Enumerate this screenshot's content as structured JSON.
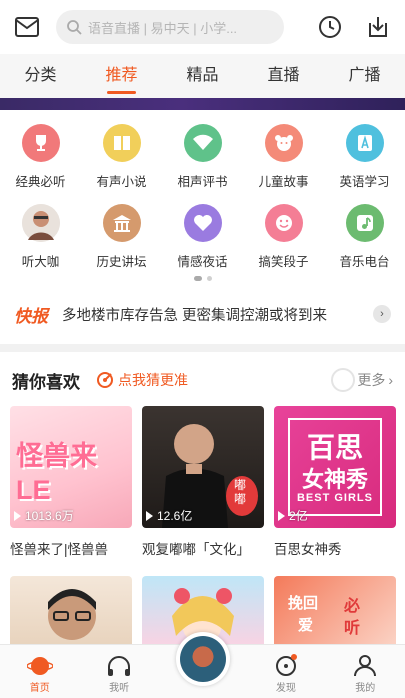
{
  "search": {
    "placeholder": "语音直播 | 易中天 | 小学..."
  },
  "tabs": [
    {
      "label": "分类"
    },
    {
      "label": "推荐"
    },
    {
      "label": "精品"
    },
    {
      "label": "直播"
    },
    {
      "label": "广播"
    }
  ],
  "categories": [
    {
      "label": "经典必听",
      "icon": "trophy-icon",
      "color": "#f1797a"
    },
    {
      "label": "有声小说",
      "icon": "book-icon",
      "color": "#f1cf5a"
    },
    {
      "label": "相声评书",
      "icon": "fan-icon",
      "color": "#5fc28a"
    },
    {
      "label": "儿童故事",
      "icon": "bear-icon",
      "color": "#f48a78"
    },
    {
      "label": "英语学习",
      "icon": "letter-a-icon",
      "color": "#4fc0de"
    },
    {
      "label": "听大咖",
      "icon": "avatar-icon",
      "color": "#a65b4a"
    },
    {
      "label": "历史讲坛",
      "icon": "temple-icon",
      "color": "#d59a6d"
    },
    {
      "label": "情感夜话",
      "icon": "heart-icon",
      "color": "#9a7be0"
    },
    {
      "label": "搞笑段子",
      "icon": "smile-icon",
      "color": "#f47e95"
    },
    {
      "label": "音乐电台",
      "icon": "music-note-icon",
      "color": "#6cbb70"
    }
  ],
  "ticker": {
    "badge": "快报",
    "text": "多地楼市库存告急 更密集调控潮或将到来"
  },
  "guess": {
    "title": "猜你喜欢",
    "button": "点我猜更准",
    "more": "更多"
  },
  "cards": [
    {
      "title": "怪兽来了|怪兽兽",
      "count": "1013.6万"
    },
    {
      "title": "观复嘟嘟「文化」",
      "count": "12.6亿"
    },
    {
      "title": "百思女神秀",
      "count": "2亿"
    }
  ],
  "cover_texts": {
    "card1": "怪兽来LE",
    "card2": "嘟嘟",
    "card3_top": "百思",
    "card3_mid": "女神秀",
    "card3_en": "BEST GIRLS",
    "card6_a": "挽回",
    "card6_b": "爱",
    "card6_c": "必",
    "card6_d": "听"
  },
  "bottom_nav": [
    {
      "label": "首页"
    },
    {
      "label": "我听"
    },
    {
      "label": "发现"
    },
    {
      "label": "我的"
    }
  ],
  "colors": {
    "accent": "#f05a22"
  }
}
